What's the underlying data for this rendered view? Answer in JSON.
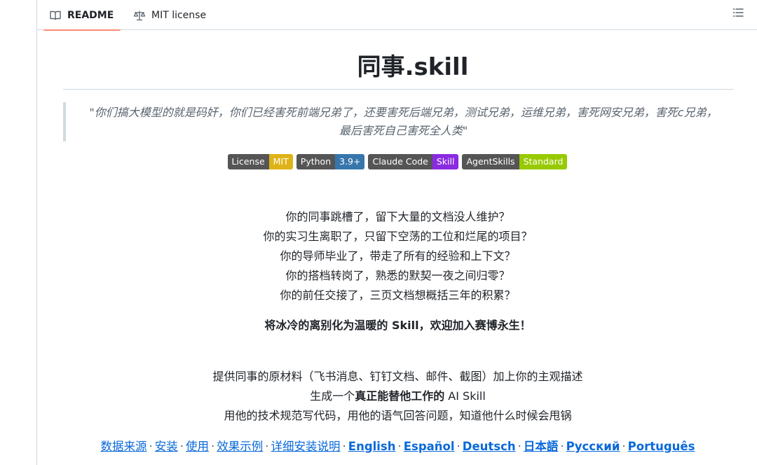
{
  "tabs": {
    "readme": "README",
    "license": "MIT license"
  },
  "title": "同事.skill",
  "quote": "\"你们搞大模型的就是码奸，你们已经害死前端兄弟了，还要害死后端兄弟，测试兄弟，运维兄弟，害死网安兄弟，害死c兄弟，最后害死自己害死全人类\"",
  "badges": [
    {
      "label": "License",
      "value": "MIT",
      "color": "#dfb317"
    },
    {
      "label": "Python",
      "value": "3.9+",
      "color": "#3776ab"
    },
    {
      "label": "Claude Code",
      "value": "Skill",
      "color": "#8a2be2"
    },
    {
      "label": "AgentSkills",
      "value": "Standard",
      "color": "#97ca00"
    }
  ],
  "intro_lines": [
    "你的同事跳槽了，留下大量的文档没人维护？",
    "你的实习生离职了，只留下空荡的工位和烂尾的项目？",
    "你的导师毕业了，带走了所有的经验和上下文？",
    "你的搭档转岗了，熟悉的默契一夜之间归零？",
    "你的前任交接了，三页文档想概括三年的积累？"
  ],
  "tagline_bold": "将冰冷的离别化为温暖的",
  "tagline_rest": " Skill，欢迎加入赛博永生！",
  "desc": {
    "line1": "提供同事的原材料（飞书消息、钉钉文档、邮件、截图）加上你的主观描述",
    "line2_pre": "生成一个",
    "line2_bold": "真正能替他工作的",
    "line2_post": " AI Skill",
    "line3": "用他的技术规范写代码，用他的语气回答问题，知道他什么时候会甩锅"
  },
  "links": [
    "数据来源",
    "安装",
    "使用",
    "效果示例",
    "详细安装说明",
    "English",
    "Español",
    "Deutsch",
    "日本語",
    "Русский",
    "Português"
  ],
  "separator": "·"
}
